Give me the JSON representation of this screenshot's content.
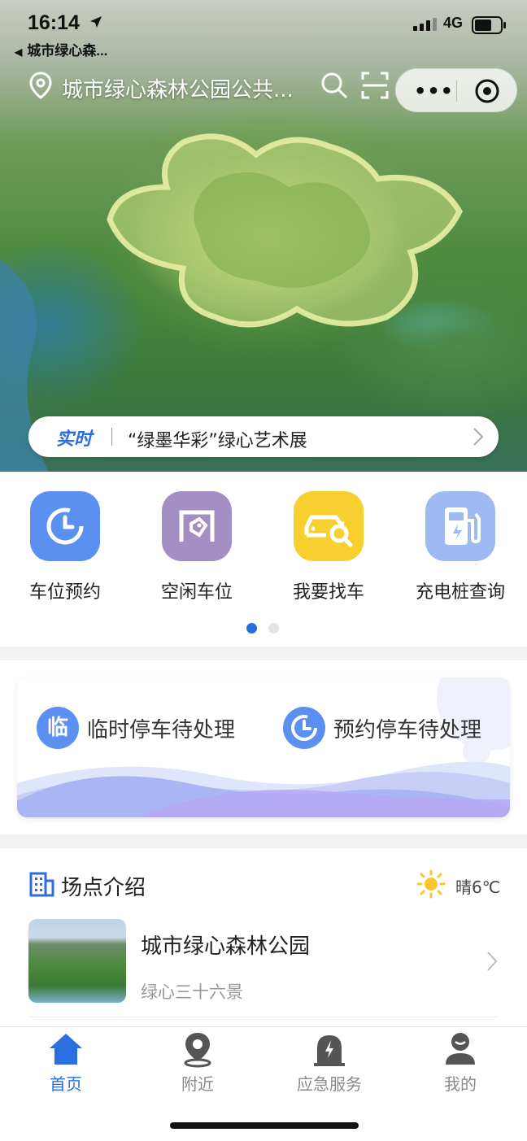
{
  "status_bar": {
    "time": "16:14",
    "network": "4G",
    "back_app_label": "城市绿心森..."
  },
  "nav": {
    "title": "城市绿心森林公园公共...",
    "menu_dots": "•••"
  },
  "realtime": {
    "tag": "实时",
    "text": "“绿墨华彩”绿心艺术展"
  },
  "quick_actions": [
    {
      "label": "车位预约",
      "icon": "clock-icon",
      "color": "#5b8ff0"
    },
    {
      "label": "空闲车位",
      "icon": "parking-tag-icon",
      "color": "#a48fc4"
    },
    {
      "label": "我要找车",
      "icon": "car-search-icon",
      "color": "#f7cf2e"
    },
    {
      "label": "充电桩查询",
      "icon": "charging-pile-icon",
      "color": "#9dbbf2"
    }
  ],
  "pending": [
    {
      "label": "临时停车待处理",
      "badge": "临"
    },
    {
      "label": "预约停车待处理",
      "icon": "clock-icon"
    }
  ],
  "site_intro": {
    "title": "场点介绍",
    "weather": "晴6℃",
    "item": {
      "name": "城市绿心森林公园",
      "subtitle": "绿心三十六景"
    }
  },
  "tabs": [
    {
      "label": "首页",
      "icon": "home-icon",
      "active": true
    },
    {
      "label": "附近",
      "icon": "location-icon",
      "active": false
    },
    {
      "label": "应急服务",
      "icon": "emergency-light-icon",
      "active": false
    },
    {
      "label": "我的",
      "icon": "user-icon",
      "active": false
    }
  ],
  "colors": {
    "accent": "#2a6ee0",
    "tab_inactive": "#8a8a8a",
    "page_indicator_active": "#2a6ee0"
  }
}
